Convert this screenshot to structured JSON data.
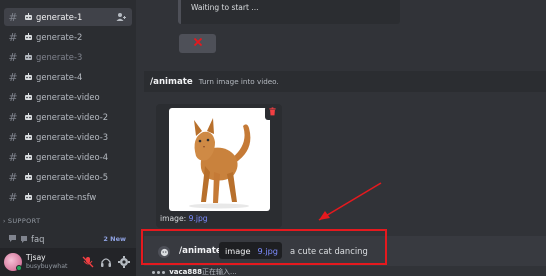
{
  "sidebar": {
    "channels": [
      {
        "label": "generate-1"
      },
      {
        "label": "generate-2"
      },
      {
        "label": "generate-3"
      },
      {
        "label": "generate-4"
      },
      {
        "label": "generate-video"
      },
      {
        "label": "generate-video-2"
      },
      {
        "label": "generate-video-3"
      },
      {
        "label": "generate-video-4"
      },
      {
        "label": "generate-video-5"
      },
      {
        "label": "generate-nsfw"
      }
    ],
    "section_label": "SUPPORT",
    "faq": {
      "label": "faq",
      "badge": "2 New"
    }
  },
  "user": {
    "name": "Tjsay",
    "status": "busybuywhat"
  },
  "main": {
    "embed_text": "Waiting to start ...",
    "command_header": {
      "name": "/animate",
      "description": "Turn image into video."
    },
    "attachment": {
      "label_prefix": "image: ",
      "filename": "9.jpg"
    },
    "input": {
      "command": "/animate",
      "option_key": "image",
      "option_value": "9.jpg",
      "prompt": "a cute cat dancing"
    },
    "typing": {
      "user": "vaca888",
      "text": "正在输入..."
    }
  },
  "colors": {
    "accent": "#5865f2",
    "highlight_border": "#e5191e",
    "cancel_icon": "#e5191e",
    "link": "#7d8cff"
  },
  "icons": {
    "hash": "#",
    "robot": "robot-icon",
    "cancel": "x-icon",
    "trash": "trash-icon"
  }
}
